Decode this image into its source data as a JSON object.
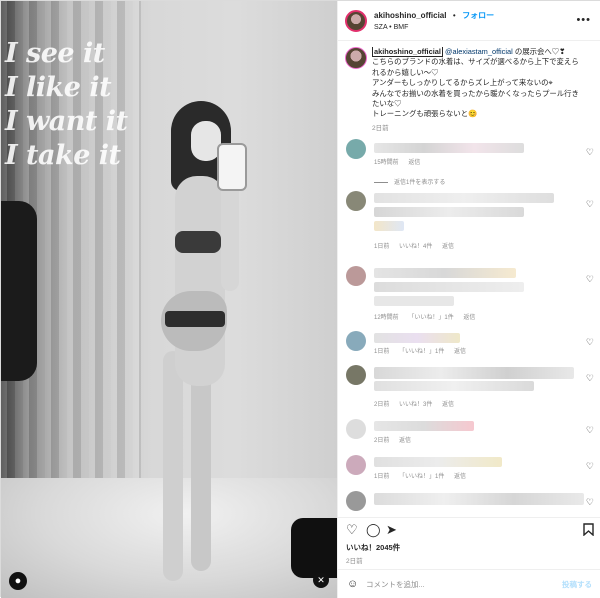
{
  "photo": {
    "wall_text": [
      "I see it",
      "I like it",
      "I want it",
      "I take it"
    ]
  },
  "header": {
    "username": "akihoshino_official",
    "dot": "•",
    "follow": "フォロー",
    "subtitle": "SZA • BMF",
    "more": "•••"
  },
  "caption": {
    "username": "akihoshino_official",
    "mention": "@alexiastam_official",
    "line1_rest": " の展示会へ♡❣",
    "lines": [
      "こちらのブランドの水着は、サイズが選べるから上下で変えら",
      "れるから嬉しい〜♡",
      "アンダーもしっかりしてるからズレ上がって来ないの⌖",
      "みんなでお揃いの水着を買ったから暖かくなったらプール行き",
      "たいな♡",
      "トレーニングも頑張らないと😊"
    ],
    "time": "2日前"
  },
  "comments": [
    {
      "meta": [
        "15時間前",
        "返信"
      ],
      "reply_link": "返信1件を表示する"
    },
    {
      "meta": [
        "1日前",
        "いいね！4件",
        "返信"
      ]
    },
    {
      "meta": [
        "12時間前",
        "「いいね！」1件",
        "返信"
      ]
    },
    {
      "meta": [
        "1日前",
        "「いいね！」1件",
        "返信"
      ]
    },
    {
      "meta": [
        "2日前",
        "いいね！3件",
        "返信"
      ]
    },
    {
      "meta": [
        "2日前",
        "返信"
      ]
    },
    {
      "meta": [
        "1日前",
        "「いいね！」1件",
        "返信"
      ]
    },
    {
      "meta": []
    }
  ],
  "actions": {
    "like_icon": "heart-outline-icon",
    "comment_icon": "comment-icon",
    "share_icon": "paper-plane-icon",
    "save_icon": "bookmark-icon"
  },
  "likes": "いいね！2045件",
  "post_time": "2日前",
  "comment_box": {
    "placeholder": "コメントを追加...",
    "post": "投稿する"
  },
  "colors": {
    "accent": "#0095f6",
    "post_disabled": "#b2dffc",
    "meta_gray": "#8e8e8e"
  }
}
